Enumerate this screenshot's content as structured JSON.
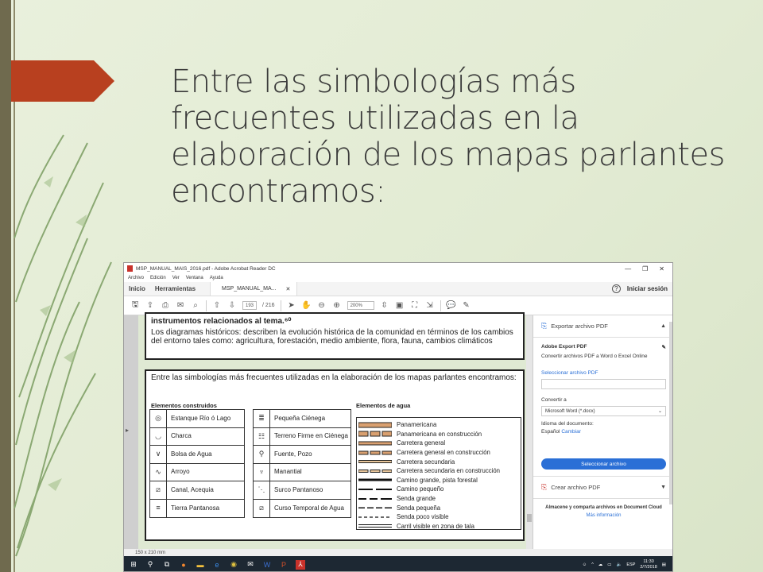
{
  "slide": {
    "title": "Entre las simbologías más frecuentes utilizadas en la elaboración de los mapas parlantes encontramos:"
  },
  "window": {
    "title": "MSP_MANUAL_MAIS_2016.pdf - Adobe Acrobat Reader DC",
    "controls": [
      "—",
      "❐",
      "✕"
    ],
    "menu": [
      "Archivo",
      "Edición",
      "Ver",
      "Ventana",
      "Ayuda"
    ],
    "tabs": {
      "home": "Inicio",
      "tools": "Herramientas",
      "doc": "MSP_MANUAL_MA...",
      "close": "✕"
    },
    "sign_in": "Iniciar sesión",
    "toolbar": {
      "page_current": "193",
      "page_total": "/ 216",
      "zoom": "200%"
    }
  },
  "document": {
    "box1_line1": "instrumentos relacionados al tema.⁶⁰",
    "box1_line2": "Los diagramas históricos: describen la evolución histórica de la comunidad en términos de los cambios del entorno tales como: agricultura, forestación, medio ambiente, flora, fauna, cambios climáticos",
    "box2_intro": "Entre las simbologías más frecuentes utilizadas en la elaboración de los mapas parlantes encontramos:",
    "built_heading": "Elementos construidos",
    "water_heading": "Elementos de agua",
    "built_left": [
      "Estanque Río ó Lago",
      "Charca",
      "Bolsa de Agua",
      "Arroyo",
      "Canal, Acequia",
      "Tierra Pantanosa"
    ],
    "built_right": [
      "Pequeña Ciénega",
      "Terreno Firme en Ciénega",
      "Fuente, Pozo",
      "Manantial",
      "Surco Pantanoso",
      "Curso Temporal de Agua"
    ],
    "roads": [
      "Panamericana",
      "Panamericana en construcción",
      "Carretera general",
      "Carretera general en construcción",
      "Carretera secundaria",
      "Carretera secundaria en construcción",
      "Camino grande, pista forestal",
      "Camino pequeño",
      "Senda grande",
      "Senda pequeña",
      "Senda poco visible",
      "Carril visible en zona de tala"
    ]
  },
  "panel": {
    "export_title": "Exportar archivo PDF",
    "export_pdf": "Adobe Export PDF",
    "export_desc": "Convertir archivos PDF a Word o Excel Online",
    "select_file": "Seleccionar archivo PDF",
    "convert_to": "Convertir a",
    "format": "Microsoft Word (*.docx)",
    "lang_label": "Idioma del documento:",
    "lang_value": "Español",
    "lang_change": "Cambiar",
    "select_button": "Seleccionar archivo",
    "create_title": "Crear archivo PDF",
    "cloud_text": "Almacene y comparta archivos en Document Cloud",
    "more_info": "Más información"
  },
  "status": {
    "size": "150 x 210 mm"
  },
  "taskbar": {
    "lang": "ESP",
    "time": "11:30",
    "date": "2/7/2018"
  }
}
